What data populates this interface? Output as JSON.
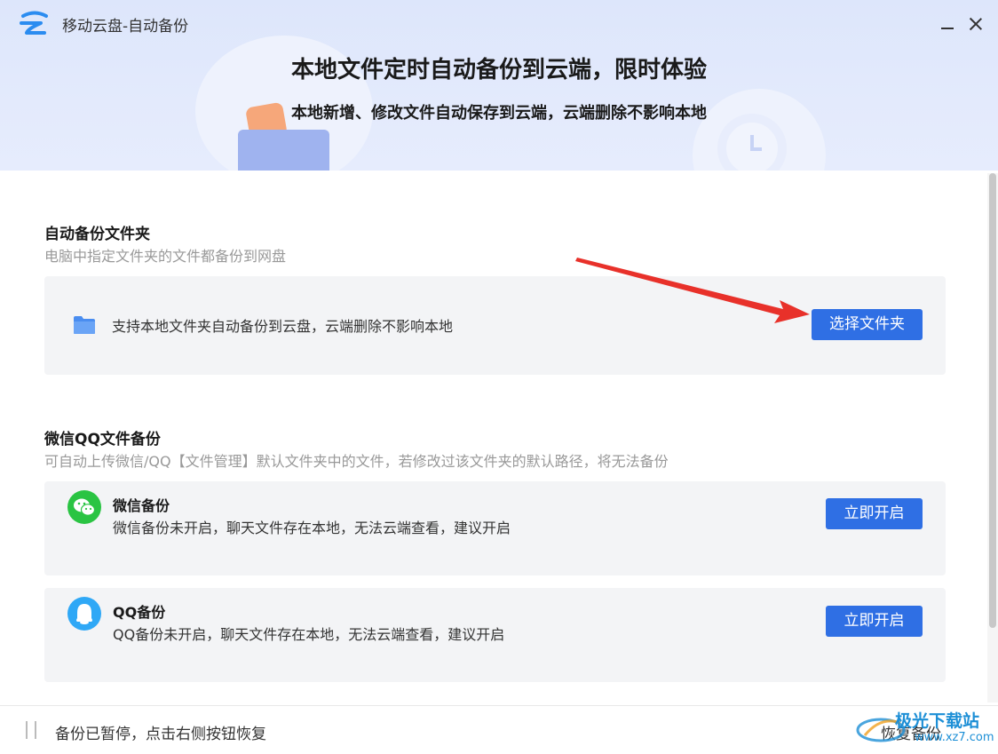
{
  "window": {
    "title": "移动云盘-自动备份",
    "controls": {
      "minimize": "minimize",
      "close": "close"
    }
  },
  "banner": {
    "headline": "本地文件定时自动备份到云端，限时体验",
    "subline": "本地新增、修改文件自动保存到云端，云端删除不影响本地"
  },
  "auto_backup": {
    "title": "自动备份文件夹",
    "description": "电脑中指定文件夹的文件都备份到网盘",
    "card_text": "支持本地文件夹自动备份到云盘，云端删除不影响本地",
    "button": "选择文件夹",
    "icon": "folder-icon"
  },
  "chat_backup": {
    "title": "微信QQ文件备份",
    "description": "可自动上传微信/QQ【文件管理】默认文件夹中的文件，若修改过该文件夹的默认路径，将无法备份",
    "items": [
      {
        "name": "微信备份",
        "desc": "微信备份未开启，聊天文件存在本地，无法云端查看，建议开启",
        "button": "立即开启",
        "icon": "wechat-icon",
        "color": "#2ac443"
      },
      {
        "name": "QQ备份",
        "desc": "QQ备份未开启，聊天文件存在本地，无法云端查看，建议开启",
        "button": "立即开启",
        "icon": "qq-icon",
        "color": "#2fa8f6"
      }
    ]
  },
  "footer": {
    "status": "备份已暂停，点击右侧按钮恢复",
    "resume": "恢复备份"
  },
  "watermark": {
    "text": "极光下载站",
    "sub": "www.xz7.com"
  },
  "colors": {
    "accent": "#2f6fe4",
    "arrow": "#e8312a",
    "banner": "#dde6fb"
  }
}
